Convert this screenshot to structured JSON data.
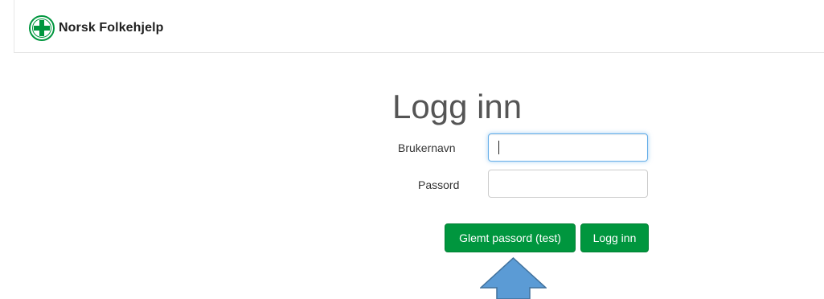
{
  "brand": {
    "name": "Norsk Folkehjelp",
    "logo_icon": "norsk-folkehjelp-cross-logo",
    "logo_color": "#00963e"
  },
  "login": {
    "title": "Logg inn",
    "username_label": "Brukernavn",
    "username_value": "",
    "password_label": "Passord",
    "password_value": "",
    "forgot_button_label": "Glemt passord (test)",
    "login_button_label": "Logg inn"
  },
  "colors": {
    "button_green": "#00963e",
    "focus_blue": "#66afe9",
    "annotation_arrow": "#5b9bd5"
  },
  "annotation": {
    "icon": "up-arrow-icon"
  }
}
